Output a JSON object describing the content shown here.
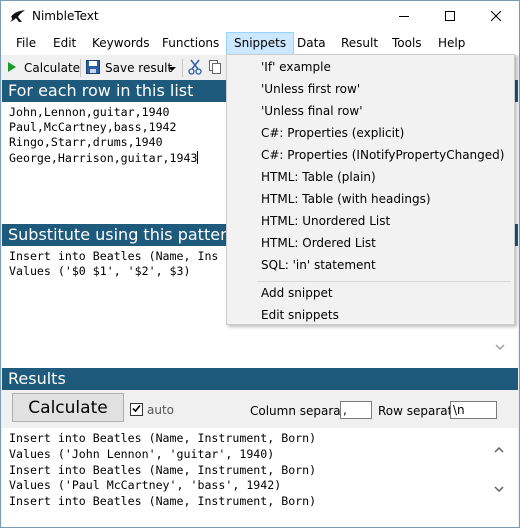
{
  "window": {
    "title": "NimbleText"
  },
  "menu": [
    "File",
    "Edit",
    "Keywords",
    "Functions",
    "Snippets",
    "Data",
    "Result",
    "Tools",
    "Help"
  ],
  "toolbar": {
    "calculate_label": "Calculate",
    "save_result_label": "Save result"
  },
  "input_panel": {
    "header": "For each row in this list",
    "lines": [
      "John,Lennon,guitar,1940",
      "Paul,McCartney,bass,1942",
      "Ringo,Starr,drums,1940",
      "George,Harrison,guitar,1943"
    ]
  },
  "pattern_panel": {
    "header": "Substitute using this pattern",
    "lines": [
      "Insert into Beatles (Name, Ins",
      "Values ('$0 $1', '$2', $3)"
    ]
  },
  "results_panel": {
    "header": "Results",
    "calculate_button": "Calculate",
    "auto_label": "auto",
    "auto_checked": true,
    "column_separator_label": "Column separator",
    "column_separator_value": ",",
    "row_separator_label": "Row separator",
    "row_separator_value": "\\n",
    "lines": [
      "Insert into Beatles (Name, Instrument, Born)",
      "Values ('John Lennon', 'guitar', 1940)",
      "Insert into Beatles (Name, Instrument, Born)",
      "Values ('Paul McCartney', 'bass', 1942)",
      "Insert into Beatles (Name, Instrument, Born)"
    ]
  },
  "snippets_menu": {
    "items": [
      "'If' example",
      "'Unless first row'",
      "'Unless final row'",
      "C#: Properties (explicit)",
      "C#: Properties (INotifyPropertyChanged)",
      "HTML: Table (plain)",
      "HTML: Table (with headings)",
      "HTML: Unordered List",
      "HTML: Ordered List",
      "SQL: 'in' statement"
    ],
    "footer_items": [
      "Add snippet",
      "Edit snippets"
    ]
  },
  "colors": {
    "section_header": "#1e5a7c",
    "menu_active": "#cce8ff"
  },
  "icons": [
    "app-logo-icon",
    "minimize-icon",
    "maximize-icon",
    "close-icon",
    "play-icon",
    "save-icon",
    "dropdown-arrow-icon",
    "cut-icon",
    "scroll-up-icon",
    "scroll-down-icon",
    "checkmark-icon"
  ]
}
